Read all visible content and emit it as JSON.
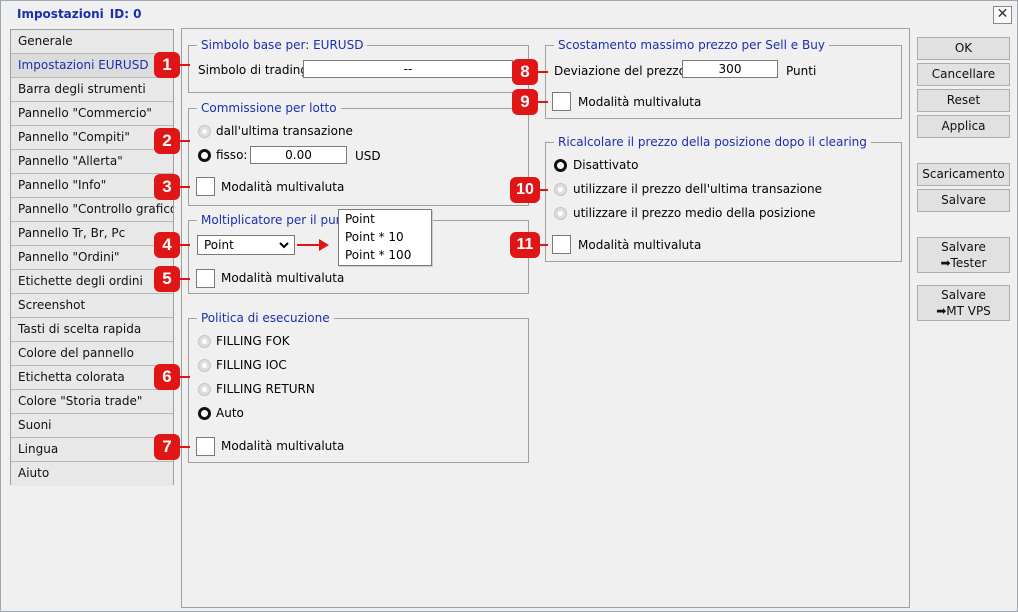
{
  "window": {
    "title": "Impostazioni",
    "id_label": "ID: 0",
    "close_glyph": "✕"
  },
  "nav": {
    "items": [
      {
        "label": "Generale"
      },
      {
        "label": "Impostazioni EURUSD"
      },
      {
        "label": "Barra degli strumenti"
      },
      {
        "label": "Pannello \"Commercio\""
      },
      {
        "label": "Pannello \"Compiti\""
      },
      {
        "label": "Pannello \"Allerta\""
      },
      {
        "label": "Pannello \"Info\""
      },
      {
        "label": "Pannello \"Controllo grafico\""
      },
      {
        "label": "Pannello Tr, Br, Pc"
      },
      {
        "label": "Pannello \"Ordini\""
      },
      {
        "label": "Etichette degli ordini"
      },
      {
        "label": "Screenshot"
      },
      {
        "label": "Tasti di scelta rapida"
      },
      {
        "label": "Colore del pannello"
      },
      {
        "label": "Etichetta colorata"
      },
      {
        "label": "Colore \"Storia trade\""
      },
      {
        "label": "Suoni"
      },
      {
        "label": "Lingua"
      },
      {
        "label": "Aiuto"
      }
    ]
  },
  "symbol_group": {
    "legend": "Simbolo base per: EURUSD",
    "label": "Simbolo di trading:",
    "value": "--"
  },
  "commission_group": {
    "legend": "Commissione per lotto",
    "option_last": "dall'ultima transazione",
    "option_fixed": "fisso:",
    "fixed_value": "0.00",
    "currency": "USD",
    "multicurrency": "Modalità multivaluta"
  },
  "multiplier_group": {
    "legend": "Moltiplicatore per il punto",
    "selected": "Point",
    "options": [
      "Point",
      "Point * 10",
      "Point * 100"
    ],
    "multicurrency": "Modalità multivaluta"
  },
  "execution_group": {
    "legend": "Politica di esecuzione",
    "options": [
      "FILLING FOK",
      "FILLING IOC",
      "FILLING RETURN",
      "Auto"
    ],
    "multicurrency": "Modalità multivaluta"
  },
  "slippage_group": {
    "legend": "Scostamento massimo prezzo per Sell e Buy",
    "label": "Deviazione del prezzo:",
    "value": "300",
    "unit": "Punti",
    "multicurrency": "Modalità multivaluta"
  },
  "recalc_group": {
    "legend": "Ricalcolare il prezzo della posizione dopo il clearing",
    "options": [
      "Disattivato",
      "utilizzare il prezzo dell'ultima transazione",
      "utilizzare il prezzo medio della posizione"
    ],
    "multicurrency": "Modalità multivaluta"
  },
  "buttons": {
    "ok": "OK",
    "cancel": "Cancellare",
    "reset": "Reset",
    "apply": "Applica",
    "download": "Scaricamento",
    "save": "Salvare",
    "save_tester_1": "Salvare",
    "save_tester_2": "➡Tester",
    "save_vps_1": "Salvare",
    "save_vps_2": "➡MT VPS"
  },
  "badges": [
    "1",
    "2",
    "3",
    "4",
    "5",
    "6",
    "7",
    "8",
    "9",
    "10",
    "11"
  ],
  "colors": {
    "accent": "#1a2fb0",
    "badge": "#e01515"
  }
}
